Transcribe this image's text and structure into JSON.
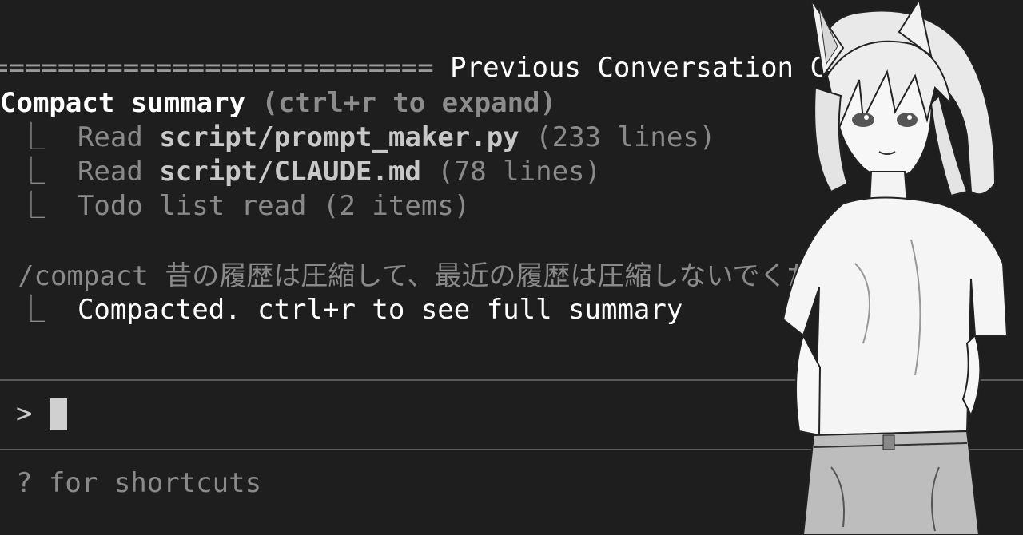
{
  "divider": {
    "equals": "===========================",
    "title": " Previous Conversation Compacted"
  },
  "summary": {
    "bullet": "",
    "label": "Compact summary",
    "hint": " (ctrl+r to expand)"
  },
  "items": [
    {
      "tree": "⎿  ",
      "verb": "Read ",
      "path": "script/prompt_maker.py",
      "meta": " (233 lines)"
    },
    {
      "tree": "⎿  ",
      "verb": "Read ",
      "path": "script/CLAUDE.md",
      "meta": " (78 lines)"
    },
    {
      "tree": "⎿  ",
      "verb": "Todo list read (2 items)",
      "path": "",
      "meta": ""
    }
  ],
  "command": {
    "text": "/compact 昔の履歴は圧縮して、最近の履歴は圧縮しないでくださ"
  },
  "result": {
    "tree": "⎿  ",
    "text": "Compacted. ctrl+r to see full summary"
  },
  "input": {
    "prompt": ">"
  },
  "footer": {
    "shortcuts": "? for shortcuts"
  }
}
